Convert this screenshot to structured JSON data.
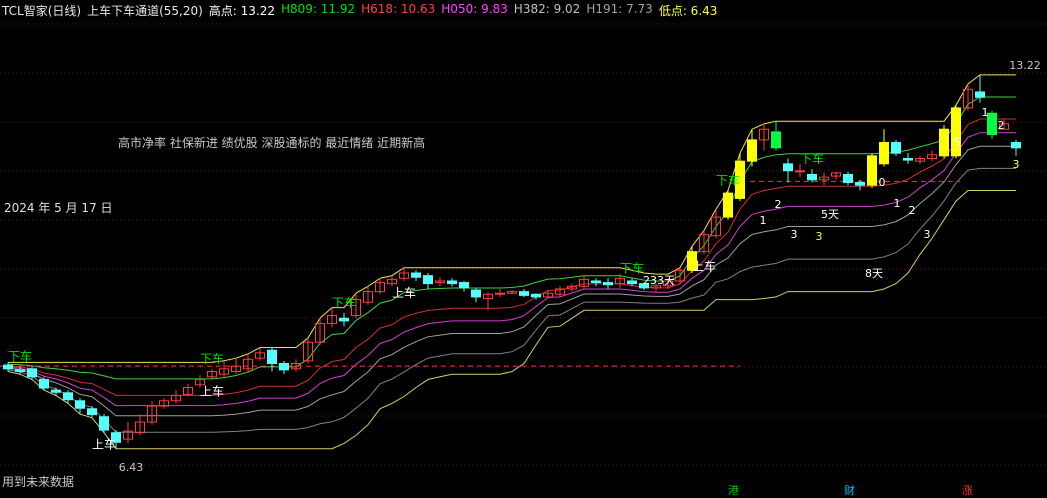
{
  "header": {
    "stock": "TCL智家(日线)",
    "indicator": "上车下车通道(55,20)",
    "values": [
      {
        "label": "高点: 13.22",
        "color": "#ffffff"
      },
      {
        "label": "H809: 11.92",
        "color": "#00e000"
      },
      {
        "label": "H618: 10.63",
        "color": "#ff4040"
      },
      {
        "label": "H050: 9.83",
        "color": "#ff40ff"
      },
      {
        "label": "H382: 9.02",
        "color": "#c0c0c0"
      },
      {
        "label": "H191: 7.73",
        "color": "#a0a0a0"
      },
      {
        "label": "低点: 6.43",
        "color": "#ffff40"
      }
    ]
  },
  "notes": {
    "caption": "高市净率 社保新进 绩优股 深股通标的 最近情绪 近期新高",
    "date": "2024 年 5 月 17 日",
    "future": "用到未来数据"
  },
  "bottom_markers": [
    {
      "text": "港",
      "color": "#00c000"
    },
    {
      "text": "财",
      "color": "#00c0ff"
    },
    {
      "text": "涨",
      "color": "#ff3030"
    }
  ],
  "chart_data": {
    "type": "candlestick",
    "ylim": [
      6.2,
      13.9
    ],
    "candles": [
      [
        8.17,
        8.1,
        8.22,
        8.05
      ],
      [
        8.08,
        8.05,
        8.14,
        8.0
      ],
      [
        8.1,
        7.95,
        8.14,
        7.9
      ],
      [
        7.9,
        7.74,
        7.95,
        7.7
      ],
      [
        7.7,
        7.66,
        7.75,
        7.6
      ],
      [
        7.65,
        7.52,
        7.7,
        7.45
      ],
      [
        7.5,
        7.36,
        7.55,
        7.25
      ],
      [
        7.35,
        7.24,
        7.4,
        7.18
      ],
      [
        7.2,
        6.95,
        7.25,
        6.9
      ],
      [
        6.9,
        6.72,
        6.95,
        6.6
      ],
      [
        6.78,
        6.93,
        7.1,
        6.7
      ],
      [
        6.9,
        7.1,
        7.25,
        6.85
      ],
      [
        7.1,
        7.4,
        7.5,
        7.05
      ],
      [
        7.4,
        7.5,
        7.55,
        7.35
      ],
      [
        7.5,
        7.6,
        7.7,
        7.45
      ],
      [
        7.62,
        7.75,
        7.82,
        7.58
      ],
      [
        7.8,
        7.9,
        7.98,
        7.75
      ],
      [
        7.95,
        8.05,
        8.1,
        7.9
      ],
      [
        8.0,
        8.1,
        8.25,
        7.95
      ],
      [
        8.05,
        8.15,
        8.3,
        8.0
      ],
      [
        8.1,
        8.28,
        8.38,
        8.05
      ],
      [
        8.3,
        8.4,
        8.5,
        8.25
      ],
      [
        8.45,
        8.2,
        8.5,
        8.05
      ],
      [
        8.2,
        8.08,
        8.25,
        8.0
      ],
      [
        8.1,
        8.2,
        8.28,
        8.05
      ],
      [
        8.25,
        8.6,
        8.68,
        8.2
      ],
      [
        8.6,
        8.95,
        9.05,
        8.55
      ],
      [
        8.95,
        9.1,
        9.25,
        8.88
      ],
      [
        9.05,
        9.0,
        9.15,
        8.9
      ],
      [
        9.1,
        9.4,
        9.52,
        9.05
      ],
      [
        9.35,
        9.55,
        9.65,
        9.3
      ],
      [
        9.55,
        9.72,
        9.8,
        9.5
      ],
      [
        9.7,
        9.78,
        9.85,
        9.65
      ],
      [
        9.8,
        9.9,
        10.0,
        9.75
      ],
      [
        9.9,
        9.82,
        9.95,
        9.75
      ],
      [
        9.85,
        9.7,
        9.9,
        9.6
      ],
      [
        9.72,
        9.75,
        9.82,
        9.65
      ],
      [
        9.75,
        9.7,
        9.8,
        9.65
      ],
      [
        9.72,
        9.62,
        9.75,
        9.55
      ],
      [
        9.58,
        9.45,
        9.62,
        9.35
      ],
      [
        9.42,
        9.5,
        9.55,
        9.2
      ],
      [
        9.5,
        9.52,
        9.6,
        9.45
      ],
      [
        9.52,
        9.55,
        9.58,
        9.5
      ],
      [
        9.55,
        9.48,
        9.6,
        9.45
      ],
      [
        9.5,
        9.45,
        9.52,
        9.4
      ],
      [
        9.45,
        9.52,
        9.58,
        9.42
      ],
      [
        9.5,
        9.6,
        9.65,
        9.45
      ],
      [
        9.6,
        9.65,
        9.7,
        9.55
      ],
      [
        9.65,
        9.78,
        9.85,
        9.6
      ],
      [
        9.75,
        9.72,
        9.8,
        9.65
      ],
      [
        9.72,
        9.68,
        9.8,
        9.6
      ],
      [
        9.7,
        9.8,
        9.88,
        9.62
      ],
      [
        9.75,
        9.7,
        9.8,
        9.65
      ],
      [
        9.7,
        9.62,
        9.72,
        9.58
      ],
      [
        9.62,
        9.66,
        9.7,
        9.55
      ],
      [
        9.66,
        9.75,
        9.8,
        9.6
      ],
      [
        9.75,
        9.95,
        10.0,
        9.7
      ],
      [
        9.95,
        10.3,
        10.4,
        9.9
      ],
      [
        10.3,
        10.62,
        10.7,
        10.25
      ],
      [
        10.6,
        10.95,
        11.1,
        10.55
      ],
      [
        10.95,
        11.4,
        11.45,
        10.9
      ],
      [
        11.3,
        12.0,
        12.15,
        11.25
      ],
      [
        12.0,
        12.4,
        12.6,
        11.9
      ],
      [
        12.4,
        12.6,
        12.7,
        12.2
      ],
      [
        12.55,
        12.25,
        12.75,
        12.2
      ],
      [
        11.95,
        11.82,
        12.05,
        11.6
      ],
      [
        11.8,
        11.82,
        11.95,
        11.7
      ],
      [
        11.75,
        11.65,
        11.85,
        11.6
      ],
      [
        11.65,
        11.7,
        11.78,
        11.55
      ],
      [
        11.72,
        11.78,
        11.8,
        11.65
      ],
      [
        11.75,
        11.6,
        11.8,
        11.55
      ],
      [
        11.6,
        11.55,
        11.65,
        11.45
      ],
      [
        11.55,
        12.1,
        12.15,
        11.5
      ],
      [
        11.95,
        12.35,
        12.6,
        11.9
      ],
      [
        12.35,
        12.15,
        12.4,
        12.1
      ],
      [
        12.05,
        12.02,
        12.15,
        11.95
      ],
      [
        12.0,
        12.05,
        12.1,
        11.95
      ],
      [
        12.05,
        12.12,
        12.2,
        12.0
      ],
      [
        12.1,
        12.6,
        12.68,
        12.05
      ],
      [
        12.1,
        13.0,
        13.05,
        12.05
      ],
      [
        13.0,
        13.35,
        13.45,
        12.95
      ],
      [
        13.3,
        13.2,
        13.62,
        13.1
      ],
      [
        12.9,
        12.5,
        12.95,
        12.42
      ],
      [
        12.6,
        12.7,
        12.8,
        12.6
      ],
      [
        12.35,
        12.25,
        12.4,
        12.1
      ]
    ],
    "signals": [
      {
        "i": 1,
        "label": "下车",
        "pos": "above",
        "color": "#00e000"
      },
      {
        "i": 8,
        "label": "上车",
        "pos": "below",
        "color": "#ffffff"
      },
      {
        "i": 17,
        "label": "下车",
        "pos": "above",
        "color": "#00e000"
      },
      {
        "i": 17,
        "label": "上车",
        "pos": "below",
        "color": "#ffffff"
      },
      {
        "i": 28,
        "label": "下车",
        "pos": "above",
        "color": "#00e000"
      },
      {
        "i": 33,
        "label": "上车",
        "pos": "below",
        "color": "#ffffff"
      },
      {
        "i": 52,
        "label": "下车",
        "pos": "above",
        "color": "#00e000"
      },
      {
        "i": 58,
        "label": "上车",
        "pos": "below",
        "color": "#ffffff"
      },
      {
        "i": 60,
        "label": "下车",
        "pos": "above",
        "color": "#00e000"
      },
      {
        "i": 67,
        "label": "下车",
        "pos": "above",
        "color": "#00e000"
      }
    ],
    "annotations": [
      {
        "i": 8,
        "text": "6.43"
      },
      {
        "i": 43,
        "text": "233天"
      },
      {
        "i": 53,
        "text": "2"
      },
      {
        "i": 54,
        "text": "3"
      },
      {
        "i": 55,
        "text": "5天"
      },
      {
        "i": 58,
        "text": "0"
      },
      {
        "i": 59,
        "text": "1"
      },
      {
        "i": 61,
        "text": "2"
      },
      {
        "i": 61,
        "text": "3"
      },
      {
        "i": 64,
        "text": "1"
      },
      {
        "i": 66,
        "text": "2"
      },
      {
        "i": 67,
        "text": "3"
      },
      {
        "i": 57,
        "text": "8天"
      },
      {
        "i": 50,
        "text": "1"
      },
      {
        "i": 52,
        "text": "3"
      },
      {
        "i": 64,
        "text": "5"
      },
      {
        "i": 66,
        "text": "13.22"
      }
    ]
  }
}
